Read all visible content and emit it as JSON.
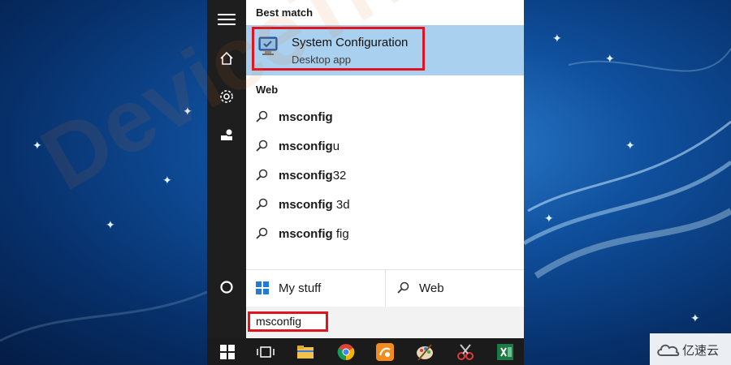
{
  "sections": {
    "best_match": "Best match",
    "web": "Web"
  },
  "best_match_item": {
    "title": "System Configuration",
    "subtitle": "Desktop app",
    "icon": "system-configuration-icon"
  },
  "suggestions": [
    {
      "bold": "msconfig",
      "rest": ""
    },
    {
      "bold": "msconfig",
      "rest": "u"
    },
    {
      "bold": "msconfig",
      "rest": "32"
    },
    {
      "bold": "msconfig",
      "rest": " 3d"
    },
    {
      "bold": "msconfig",
      "rest": " fig"
    }
  ],
  "scope_tabs": {
    "my_stuff": "My stuff",
    "web": "Web"
  },
  "search": {
    "value": "msconfig"
  },
  "watermark": "DeviceTricks",
  "logo": {
    "text": "亿速云"
  },
  "colors": {
    "highlight": "#a9d0ee",
    "annotation_red": "#e0141e",
    "rail": "#1e1e1e",
    "taskbar": "#1b1b1b"
  }
}
